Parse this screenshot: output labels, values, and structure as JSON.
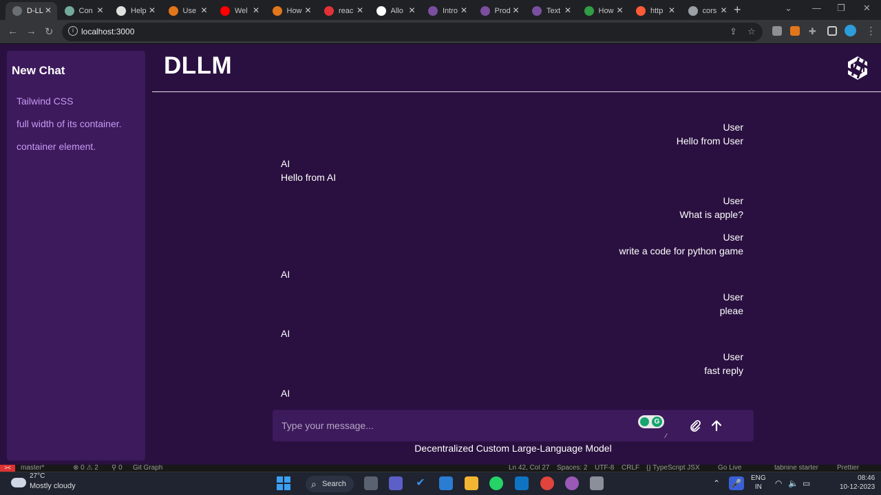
{
  "browser": {
    "tabs": [
      {
        "label": "D-LL",
        "color": "#6b6f74",
        "active": true
      },
      {
        "label": "Con",
        "color": "#74aa9c"
      },
      {
        "label": "Help",
        "color": "#e0e0e0"
      },
      {
        "label": "Use",
        "color": "#e2761b"
      },
      {
        "label": "Wel",
        "color": "#ff0000"
      },
      {
        "label": "How",
        "color": "#e2761b"
      },
      {
        "label": "reac",
        "color": "#e23237"
      },
      {
        "label": "Allo",
        "color": "#ffffff"
      },
      {
        "label": "Intro",
        "color": "#7b4fa0"
      },
      {
        "label": "Prod",
        "color": "#7b4fa0"
      },
      {
        "label": "Text",
        "color": "#7b4fa0"
      },
      {
        "label": "How",
        "color": "#2f9e44"
      },
      {
        "label": "http",
        "color": "#ff5a36"
      },
      {
        "label": "cors",
        "color": "#9aa0a6"
      }
    ],
    "url": "localhost:3000"
  },
  "sidebar": {
    "new_chat": "New Chat",
    "history": [
      "Tailwind CSS",
      "full width of its container.",
      "container element."
    ]
  },
  "header": {
    "brand": "DLLM"
  },
  "messages": [
    {
      "role": "user",
      "who": "User",
      "text": "Hello from User"
    },
    {
      "role": "ai",
      "who": "AI",
      "text": "Hello from AI"
    },
    {
      "role": "user",
      "who": "User",
      "text": "What is apple?"
    },
    {
      "role": "user",
      "who": "User",
      "text": "write a code for python game"
    },
    {
      "role": "ai",
      "who": "AI",
      "text": ""
    },
    {
      "role": "user",
      "who": "User",
      "text": "pleae"
    },
    {
      "role": "ai",
      "who": "AI",
      "text": ""
    },
    {
      "role": "user",
      "who": "User",
      "text": "fast reply"
    },
    {
      "role": "ai",
      "who": "AI",
      "text": ""
    }
  ],
  "composer": {
    "placeholder": "Type your message...",
    "grammarly": "G"
  },
  "footer": "Decentralized Custom Large-Language Model",
  "vscode_status": {
    "branch": "master*",
    "problems": "⊗ 0 ⚠ 2",
    "ports": "⚲ 0",
    "git_graph": "Git Graph",
    "position": "Ln 42, Col 27",
    "spaces": "Spaces: 2",
    "encoding": "UTF-8",
    "eol": "CRLF",
    "language": "{} TypeScript JSX",
    "golive": "Go Live",
    "tabnine": "tabnine starter",
    "prettier": "Prettier"
  },
  "taskbar": {
    "temperature": "27°C",
    "weather": "Mostly cloudy",
    "search": "Search",
    "lang_top": "ENG",
    "lang_bottom": "IN",
    "time": "08:46",
    "date": "10-12-2023"
  }
}
